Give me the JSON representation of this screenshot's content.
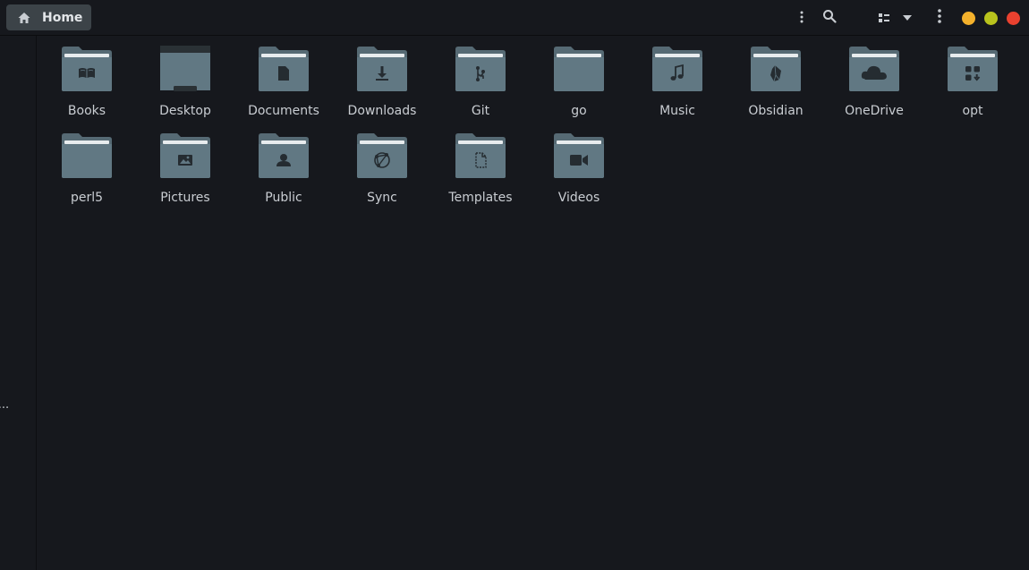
{
  "header": {
    "path_label": "Home"
  },
  "sidebar": {
    "truncated_label": "o..."
  },
  "folders": [
    {
      "name": "Books",
      "icon": "book-icon"
    },
    {
      "name": "Desktop",
      "icon": "desktop-icon"
    },
    {
      "name": "Documents",
      "icon": "document-icon"
    },
    {
      "name": "Downloads",
      "icon": "download-icon"
    },
    {
      "name": "Git",
      "icon": "git-icon"
    },
    {
      "name": "go",
      "icon": "none"
    },
    {
      "name": "Music",
      "icon": "music-icon"
    },
    {
      "name": "Obsidian",
      "icon": "obsidian-icon"
    },
    {
      "name": "OneDrive",
      "icon": "cloud-icon"
    },
    {
      "name": "opt",
      "icon": "apps-icon"
    },
    {
      "name": "perl5",
      "icon": "none"
    },
    {
      "name": "Pictures",
      "icon": "image-icon"
    },
    {
      "name": "Public",
      "icon": "user-icon"
    },
    {
      "name": "Sync",
      "icon": "sync-icon"
    },
    {
      "name": "Templates",
      "icon": "template-icon"
    },
    {
      "name": "Videos",
      "icon": "video-icon"
    }
  ],
  "colors": {
    "folder_body": "#617883",
    "folder_tab": "#566a74",
    "folder_paper": "#e8ecee",
    "glyph": "#252c31",
    "minimize": "#f4b12c",
    "maximize": "#b9c31d",
    "close": "#e9412f"
  }
}
